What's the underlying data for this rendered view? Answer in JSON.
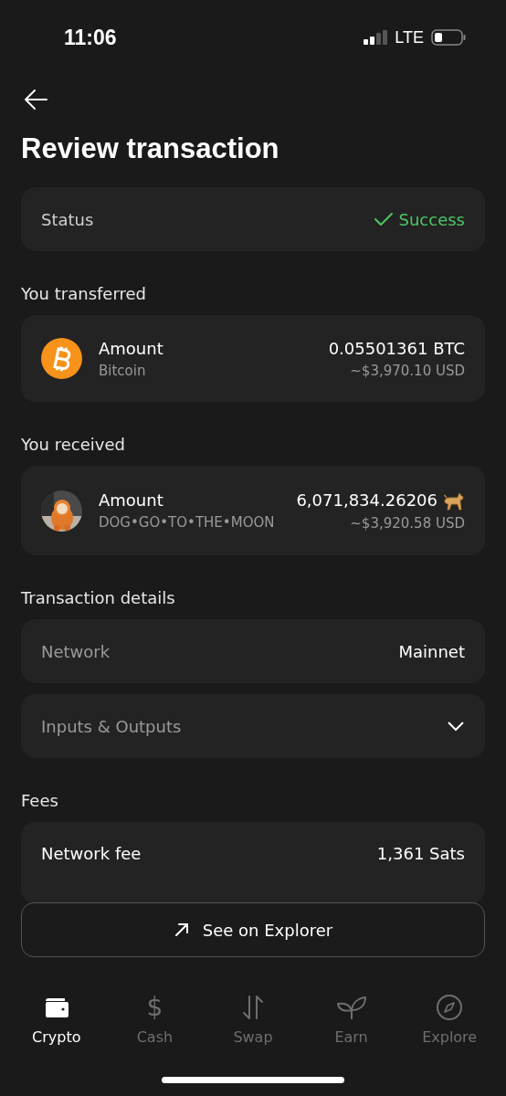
{
  "status_bar": {
    "time": "11:06",
    "network": "LTE"
  },
  "title": "Review transaction",
  "status": {
    "label": "Status",
    "value": "Success"
  },
  "transferred": {
    "heading": "You transferred",
    "label": "Amount",
    "asset": "Bitcoin",
    "amount": "0.05501361 BTC",
    "fiat": "~$3,970.10 USD"
  },
  "received": {
    "heading": "You received",
    "label": "Amount",
    "asset": "DOG•GO•TO•THE•MOON",
    "amount": "6,071,834.26206",
    "fiat": "~$3,920.58 USD"
  },
  "details": {
    "heading": "Transaction details",
    "network_label": "Network",
    "network_value": "Mainnet",
    "io_label": "Inputs & Outputs",
    "expanded": false
  },
  "fees": {
    "heading": "Fees",
    "label": "Network fee",
    "value": "1,361 Sats"
  },
  "explorer_button": "See on Explorer",
  "tabs": [
    {
      "label": "Crypto",
      "selected": true
    },
    {
      "label": "Cash",
      "glyph": "$",
      "selected": false
    },
    {
      "label": "Swap",
      "selected": false
    },
    {
      "label": "Earn",
      "selected": false
    },
    {
      "label": "Explore",
      "selected": false
    }
  ]
}
